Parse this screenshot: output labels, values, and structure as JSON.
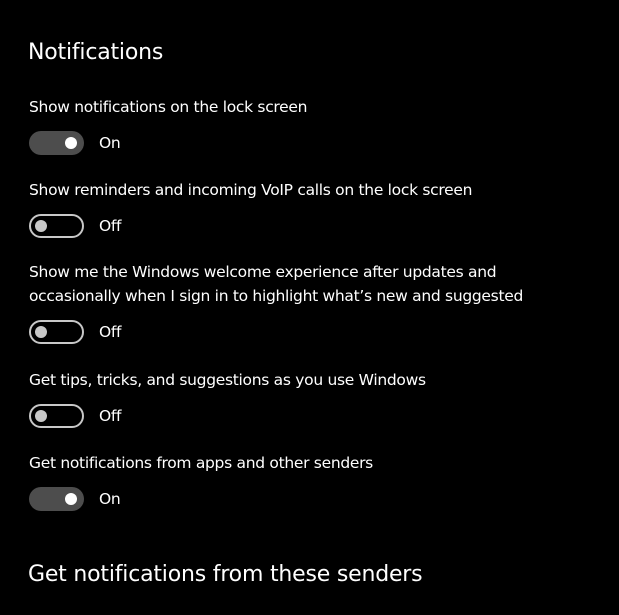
{
  "page": {
    "title": "Notifications"
  },
  "settings": [
    {
      "label": "Show notifications on the lock screen",
      "state": "on",
      "state_label": "On"
    },
    {
      "label": "Show reminders and incoming VoIP calls on the lock screen",
      "state": "off",
      "state_label": "Off"
    },
    {
      "label_line1": "Show me the Windows welcome experience after updates and",
      "label_line2": "occasionally when I sign in to highlight what’s new and suggested",
      "state": "off",
      "state_label": "Off"
    },
    {
      "label": "Get tips, tricks, and suggestions as you use Windows",
      "state": "off",
      "state_label": "Off"
    },
    {
      "label": "Get notifications from apps and other senders",
      "state": "on",
      "state_label": "On"
    }
  ],
  "senders_section": {
    "title": "Get notifications from these senders"
  },
  "colors": {
    "background": "#000000",
    "text": "#ffffff",
    "toggle_on_fill": "#4d4d4d",
    "toggle_on_knob": "#ffffff",
    "toggle_off_border": "#c8c8c8",
    "toggle_off_knob": "#c8c8c8"
  }
}
